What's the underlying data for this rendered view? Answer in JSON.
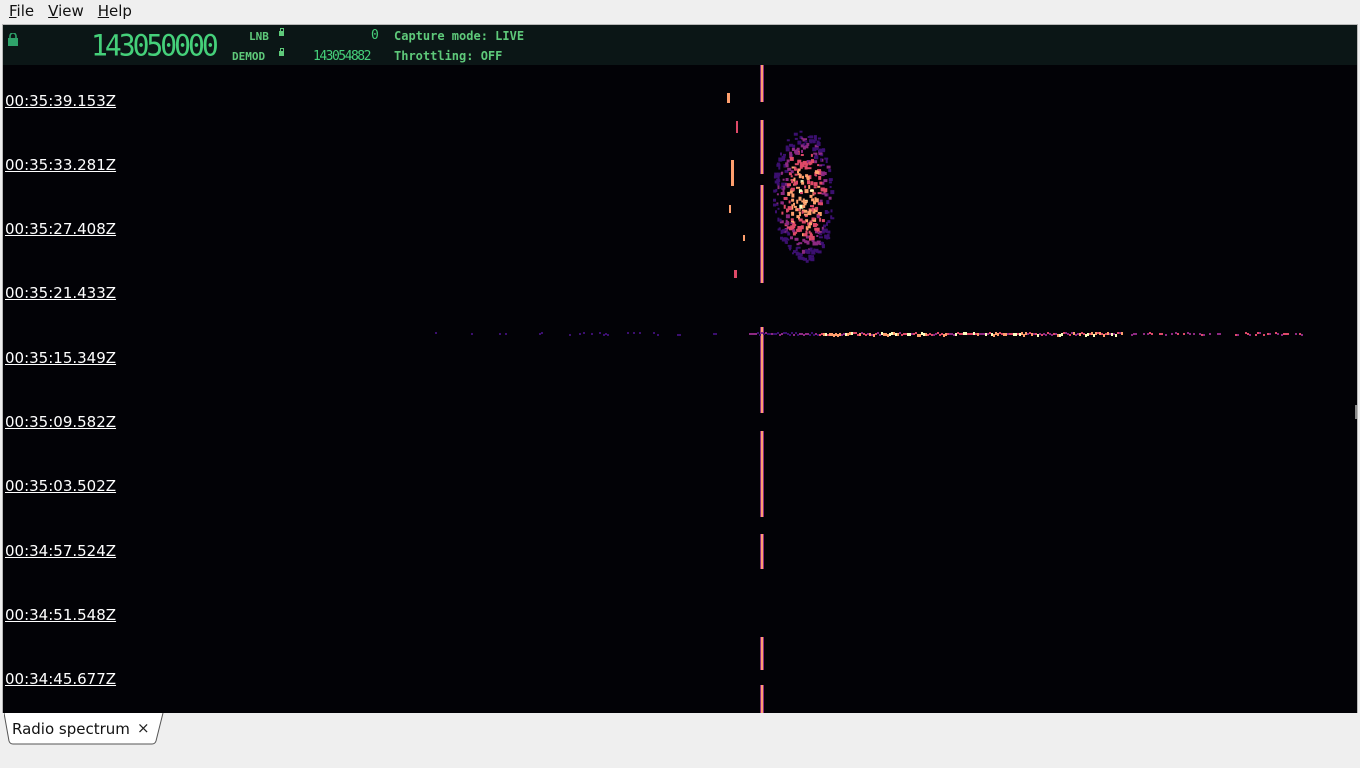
{
  "menu": {
    "file": {
      "first": "F",
      "rest": "ile"
    },
    "view": {
      "first": "V",
      "rest": "iew"
    },
    "help": {
      "first": "H",
      "rest": "elp"
    }
  },
  "header": {
    "center_frequency": "143050000",
    "lnb_label": "LNB",
    "lnb_value": "0",
    "demod_label": "DEMOD",
    "demod_value": "143054882",
    "capture_mode": "Capture mode: LIVE",
    "throttling": "Throttling: OFF",
    "text_color": "#5ec97a"
  },
  "waterfall": {
    "timestamps": [
      "00:35:39.153Z",
      "00:35:33.281Z",
      "00:35:27.408Z",
      "00:35:21.433Z",
      "00:35:15.349Z",
      "00:35:09.582Z",
      "00:35:03.502Z",
      "00:34:57.524Z",
      "00:34:51.548Z",
      "00:34:45.677Z"
    ],
    "colormap": [
      "#020206",
      "#3b0f6f",
      "#8c2981",
      "#de4968",
      "#fe9f6d",
      "#fcfdbf"
    ]
  },
  "tabs": [
    {
      "label": "Radio spectrum",
      "close": "×"
    }
  ]
}
